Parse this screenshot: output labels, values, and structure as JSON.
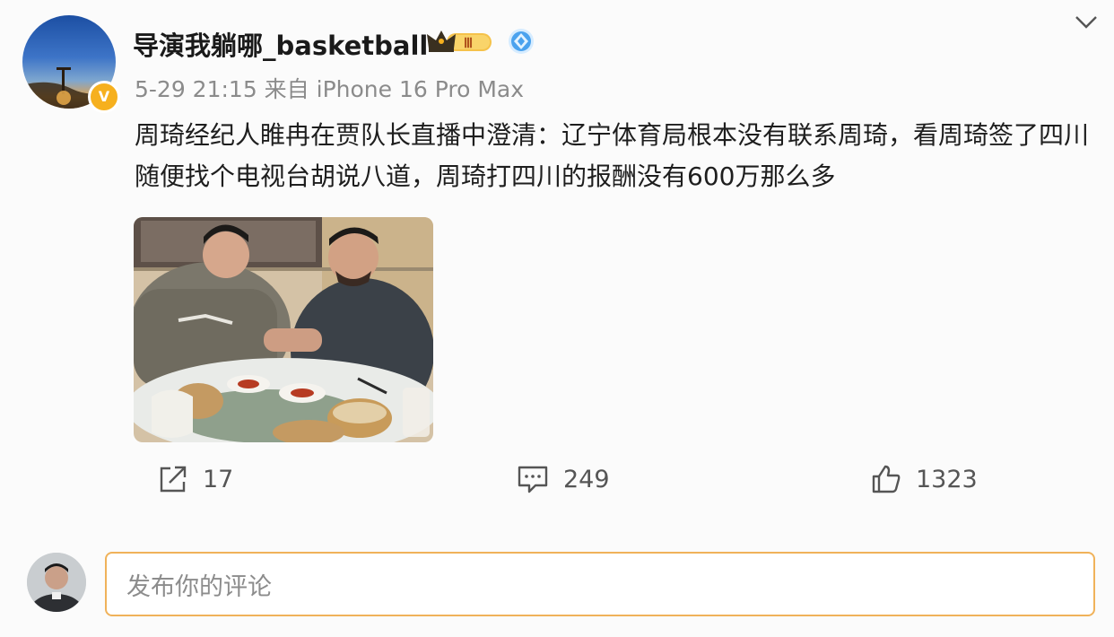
{
  "post": {
    "username": "导演我躺哪_basketball",
    "level_badge": "Ⅲ",
    "verified_mark": "V",
    "meta": "5-29 21:15 来自 iPhone 16 Pro Max",
    "content": "周琦经纪人睢冉在贾队长直播中澄清：辽宁体育局根本没有联系周琦，看周琦签了四川随便找个电视台胡说八道，周琦打四川的报酬没有600万那么多",
    "icons": [
      "crown-badge-icon",
      "blue-diamond-badge-icon",
      "chevron-down-icon"
    ]
  },
  "actions": {
    "share": {
      "icon": "share-icon",
      "count": "17"
    },
    "comment": {
      "icon": "comment-icon",
      "count": "249"
    },
    "like": {
      "icon": "thumbs-up-icon",
      "count": "1323"
    }
  },
  "comment_input": {
    "placeholder": "发布你的评论"
  },
  "colors": {
    "accent_border": "#f0b25a",
    "badge_gold": "#f6b01e",
    "muted_text": "#8b8b8b"
  }
}
